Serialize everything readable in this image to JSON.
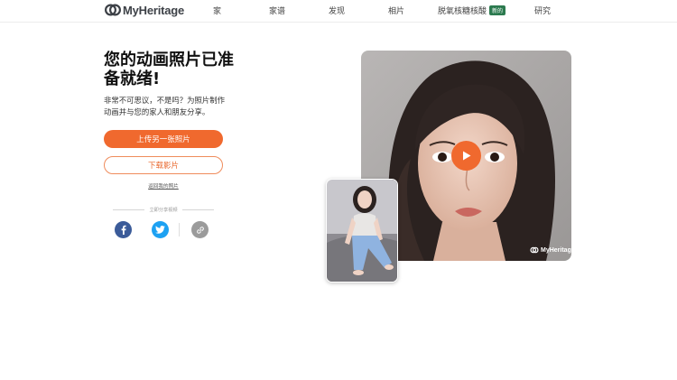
{
  "brand": {
    "name": "MyHeritage"
  },
  "nav": {
    "items": [
      {
        "label": "家"
      },
      {
        "label": "家谱"
      },
      {
        "label": "发现"
      },
      {
        "label": "相片"
      },
      {
        "label": "脱氧核糖核酸",
        "badge": "新的"
      },
      {
        "label": "研究"
      }
    ]
  },
  "hero": {
    "headline": "您的动画照片已准备就绪!",
    "subtext": "非常不可思议，不是吗？为照片制作动画并与您的家人和朋友分享。",
    "upload_button": "上传另一张照片",
    "download_button": "下载影片",
    "back_link": "返回我的照片",
    "share_label": "立即分享视频"
  },
  "media": {
    "watermark": "MyHeritage",
    "play_icon": "play-icon"
  },
  "colors": {
    "accent": "#f0692e",
    "facebook": "#3b5b99",
    "twitter": "#1da1f2",
    "link": "#9b9b9b",
    "badge": "#2c7a4f"
  }
}
